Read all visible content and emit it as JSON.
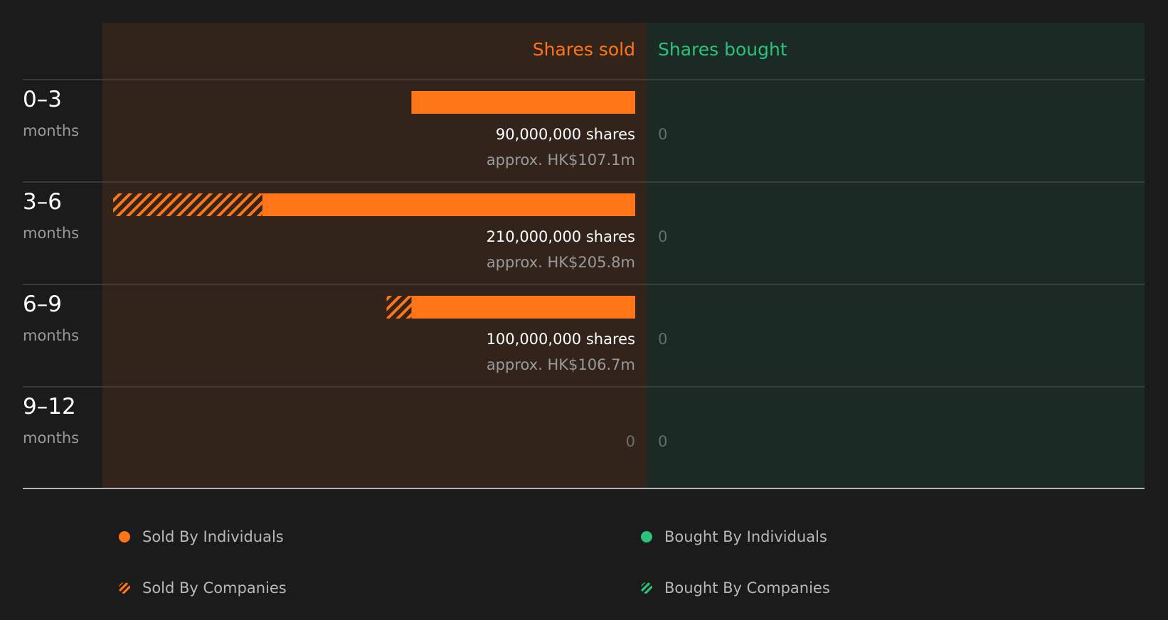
{
  "colors": {
    "sold": "#ff7518",
    "bought": "#2bc27a",
    "sold_panel": "#32231b",
    "bought_panel": "#1b2a25",
    "background": "#1b1b1b"
  },
  "chart_data": {
    "type": "bar",
    "orientation": "horizontal-diverging",
    "headers": {
      "sold": "Shares sold",
      "bought": "Shares bought"
    },
    "categories": [
      {
        "label": "0–3",
        "unit": "months"
      },
      {
        "label": "3–6",
        "unit": "months"
      },
      {
        "label": "6–9",
        "unit": "months"
      },
      {
        "label": "9–12",
        "unit": "months"
      }
    ],
    "series": [
      {
        "name": "Sold By Individuals",
        "side": "sold",
        "pattern": "solid",
        "values": [
          90000000,
          150000000,
          90000000,
          0
        ]
      },
      {
        "name": "Sold By Companies",
        "side": "sold",
        "pattern": "hatched",
        "values": [
          0,
          60000000,
          10000000,
          0
        ]
      },
      {
        "name": "Bought By Individuals",
        "side": "bought",
        "pattern": "solid",
        "values": [
          0,
          0,
          0,
          0
        ]
      },
      {
        "name": "Bought By Companies",
        "side": "bought",
        "pattern": "hatched",
        "values": [
          0,
          0,
          0,
          0
        ]
      }
    ],
    "sold_labels": [
      {
        "shares": "90,000,000 shares",
        "value": "approx. HK$107.1m"
      },
      {
        "shares": "210,000,000 shares",
        "value": "approx. HK$205.8m"
      },
      {
        "shares": "100,000,000 shares",
        "value": "approx. HK$106.7m"
      },
      {
        "shares": "0",
        "value": ""
      }
    ],
    "bought_labels": [
      "0",
      "0",
      "0",
      "0"
    ],
    "xlim": [
      0,
      210000000
    ],
    "legend_position": "bottom"
  }
}
